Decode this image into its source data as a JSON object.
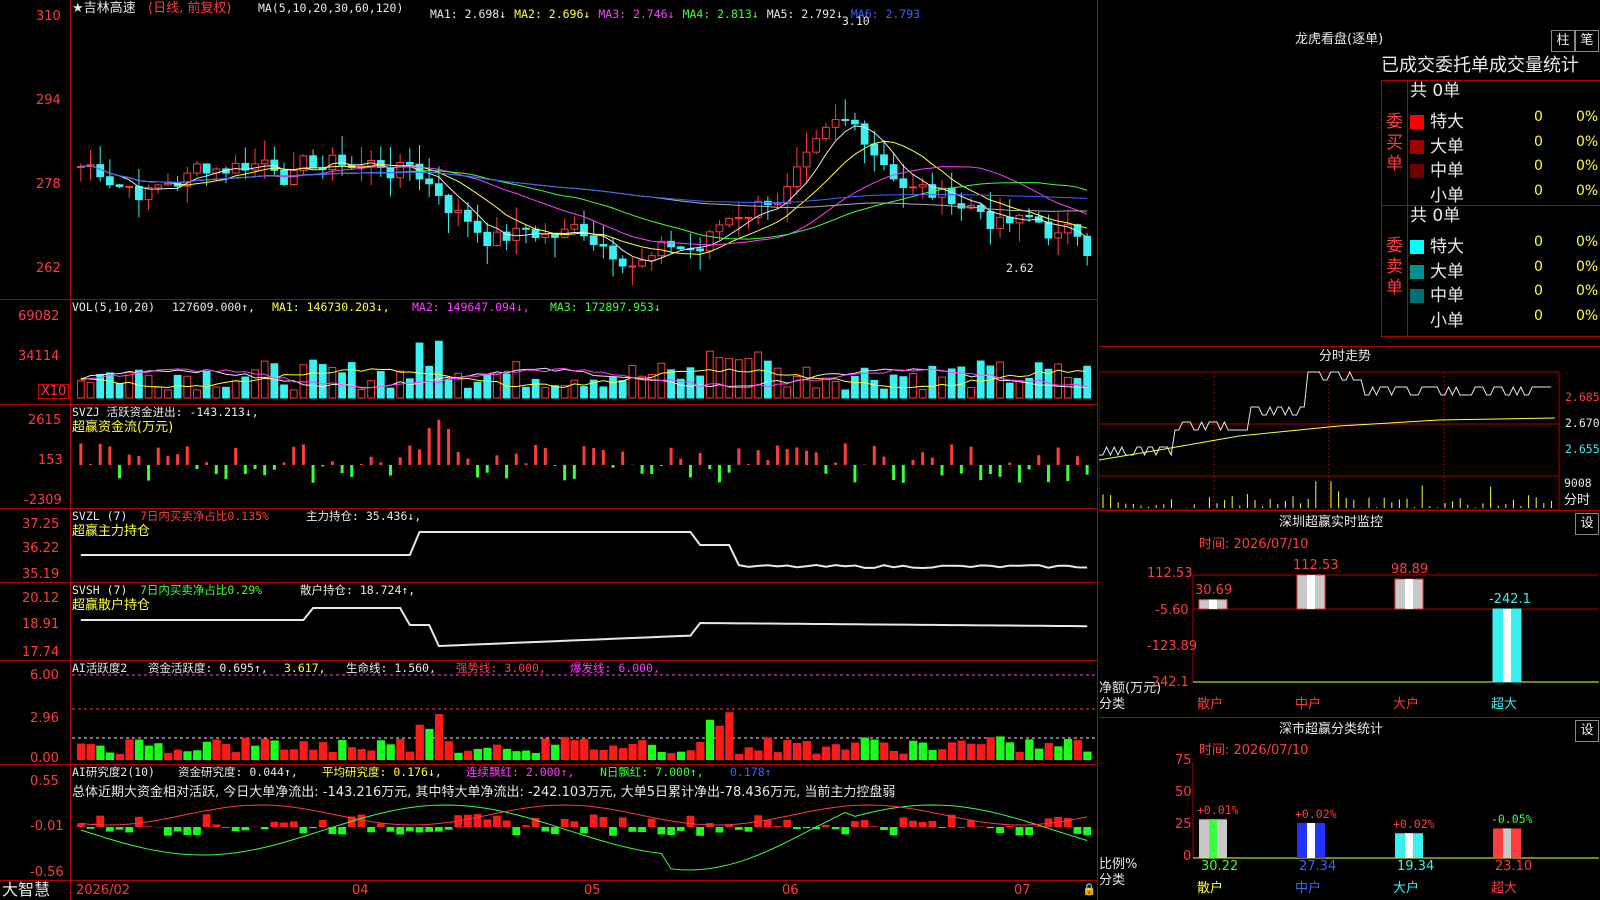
{
  "stock": {
    "title": "★吉林高速",
    "mode": "(日线, 前复权)",
    "ma_header": "MA(5,10,20,30,60,120)",
    "ma": [
      {
        "text": "MA1: 2.698↓",
        "color": "#e8e8e8"
      },
      {
        "text": "MA2: 2.696↓",
        "color": "#ffff3a"
      },
      {
        "text": "MA3: 2.746↓",
        "color": "#ff3cff"
      },
      {
        "text": "MA4: 2.813↓",
        "color": "#3cff3c"
      },
      {
        "text": "MA5: 2.792↓",
        "color": "#e8e8e8"
      },
      {
        "text": "MA6: 2.793",
        "color": "#3c64ff"
      }
    ],
    "y_ticks": [
      "310",
      "294",
      "278",
      "262"
    ],
    "high_note": "3.10",
    "low_note": "2.62"
  },
  "vol": {
    "header": "VOL(5,10,20)",
    "value": "127609.000↑,",
    "ma1": "MA1: 146730.203↓,",
    "ma2": "MA2: 149647.094↓,",
    "ma3": "MA3: 172897.953↓",
    "y_ticks": [
      "69082",
      "34114"
    ],
    "unit": "X10"
  },
  "svzj": {
    "header": "SVZJ  活跃资金进出: -143.213↓,",
    "sub": "超赢资金流(万元)",
    "y_ticks": [
      "2615",
      "153",
      "-2309"
    ]
  },
  "svzl": {
    "header": "SVZL (7)",
    "desc": "7日内买卖净占比0.135%",
    "value": "主力持仓: 35.436↓,",
    "sub": "超赢主力持仓",
    "y_ticks": [
      "37.25",
      "36.22",
      "35.19"
    ]
  },
  "svsh": {
    "header": "SVSH (7)",
    "desc": "7日内买卖净占比0.29%",
    "value": "散户持仓: 18.724↑,",
    "sub": "超赢散户持仓",
    "y_ticks": [
      "20.12",
      "18.91",
      "17.74"
    ]
  },
  "ai_active": {
    "header": "AI活跃度2",
    "text1": "资金活跃度: 0.695↑,",
    "text2": "3.617,",
    "text3": "生命线: 1.560,",
    "text4": "强势线: 3.000,",
    "text5": "爆发线: 6.000,",
    "y_ticks": [
      "6.00",
      "2.96",
      "0.00"
    ]
  },
  "ai_research": {
    "header": "AI研究度2(10)",
    "text1": "资金研究度: 0.044↑,",
    "text2": "平均研究度: 0.176↓,",
    "text3": "连续飘红: 2.000↑,",
    "text4": "N日飘红: 7.000↑,",
    "text5": "0.178↑",
    "summary": "总体近期大资金相对活跃, 今日大单净流出: -143.216万元, 其中特大单净流出: -242.103万元, 大单5日累计净出-78.436万元, 当前主力控盘弱",
    "y_ticks": [
      "0.55",
      "-0.01",
      "-0.56"
    ]
  },
  "xaxis": {
    "brand": "大智慧",
    "labels": [
      "2026/02",
      "04",
      "05",
      "06",
      "07"
    ]
  },
  "right": {
    "lhb_title": "龙虎看盘(逐单)",
    "btn_zhu": "柱",
    "btn_bi": "笔",
    "order_title": "已成交委托单成交量统计",
    "buy_side_label": "委买单",
    "sell_side_label": "委卖单",
    "buy_total": "共 0单",
    "sell_total": "共 0单",
    "buy_rows": [
      {
        "name": "特大",
        "value": "0",
        "pct": "0%",
        "color": "#ff0000"
      },
      {
        "name": "大单",
        "value": "0",
        "pct": "0%",
        "color": "#a00000"
      },
      {
        "name": "中单",
        "value": "0",
        "pct": "0%",
        "color": "#700000"
      },
      {
        "name": "小单",
        "value": "0",
        "pct": "0%",
        "color": "#000000"
      }
    ],
    "sell_rows": [
      {
        "name": "特大",
        "value": "0",
        "pct": "0%",
        "color": "#00ffff"
      },
      {
        "name": "大单",
        "value": "0",
        "pct": "0%",
        "color": "#009090"
      },
      {
        "name": "中单",
        "value": "0",
        "pct": "0%",
        "color": "#007070"
      },
      {
        "name": "小单",
        "value": "0",
        "pct": "0%",
        "color": "#000000"
      }
    ],
    "fenshi_title": "分时走势",
    "fenshi_ticks": [
      "2.685",
      "2.670",
      "2.655"
    ],
    "fenshi_vol": "9008",
    "fenshi_unit": "分时",
    "sz_title": "深圳超赢实时监控",
    "sz_btn": "设",
    "sz_time": "时间: 2026/07/10",
    "sz_yticks": [
      "112.53",
      "-5.60",
      "-123.89",
      "-242.1"
    ],
    "sz_ylabel": "净额(万元)",
    "sz_xlabel": "分类",
    "sz_bars": [
      {
        "name": "散户",
        "value": 30.69,
        "label": "30.69"
      },
      {
        "name": "中户",
        "value": 112.53,
        "label": "112.53"
      },
      {
        "name": "大户",
        "value": 98.89,
        "label": "98.89"
      },
      {
        "name": "超大",
        "value": -242.1,
        "label": "-242.1"
      }
    ],
    "ss_title": "深市超赢分类统计",
    "ss_btn": "设",
    "ss_time": "时间: 2026/07/10",
    "ss_yticks": [
      "75",
      "50",
      "25",
      "0"
    ],
    "ss_ylabel": "比例%",
    "ss_xlabel": "分类",
    "ss_bars": [
      {
        "name": "散户",
        "value": 30.22,
        "label": "30.22",
        "delta": "+0.01%"
      },
      {
        "name": "中户",
        "value": 27.34,
        "label": "27.34",
        "delta": "+0.02%"
      },
      {
        "name": "大户",
        "value": 19.34,
        "label": "19.34",
        "delta": "+0.02%"
      },
      {
        "name": "超大",
        "value": 23.1,
        "label": "23.10",
        "delta": "-0.05%"
      }
    ]
  }
}
